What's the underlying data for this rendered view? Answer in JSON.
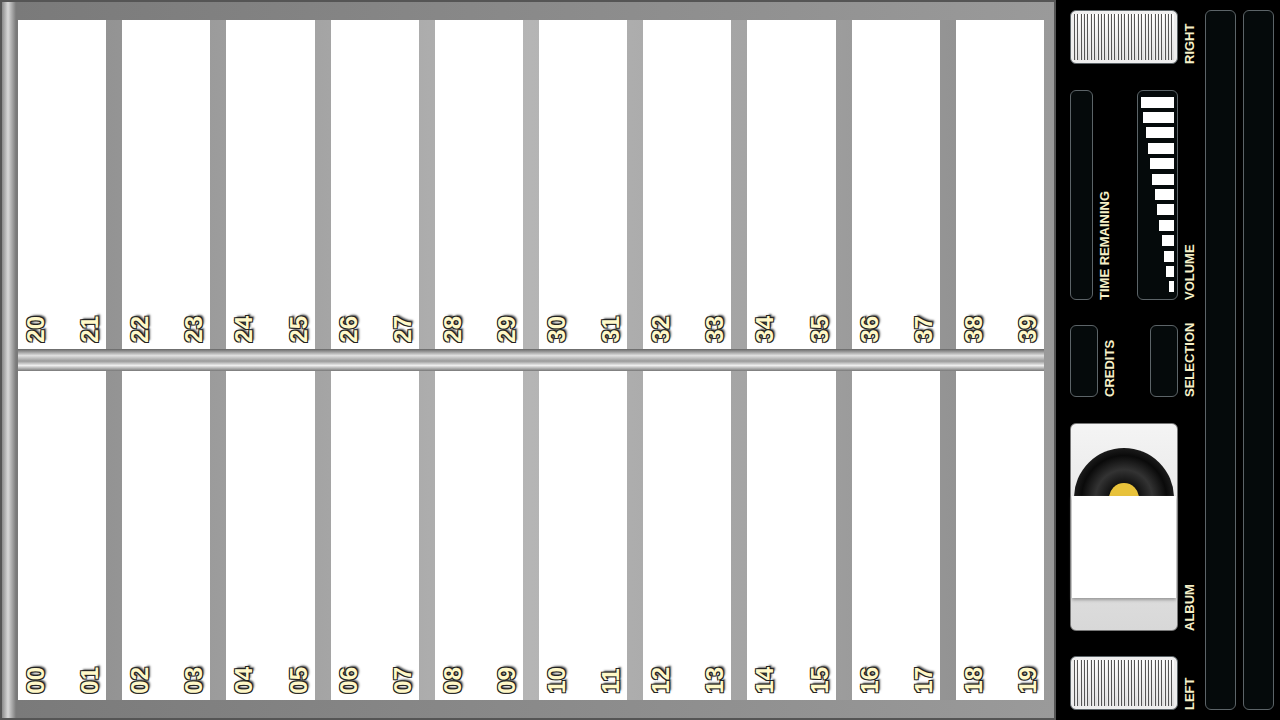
{
  "jukebox": {
    "top_row": [
      {
        "left": "20",
        "right": "21"
      },
      {
        "left": "22",
        "right": "23"
      },
      {
        "left": "24",
        "right": "25"
      },
      {
        "left": "26",
        "right": "27"
      },
      {
        "left": "28",
        "right": "29"
      },
      {
        "left": "30",
        "right": "31"
      },
      {
        "left": "32",
        "right": "33"
      },
      {
        "left": "34",
        "right": "35"
      },
      {
        "left": "36",
        "right": "37"
      },
      {
        "left": "38",
        "right": "39"
      }
    ],
    "bottom_row": [
      {
        "left": "00",
        "right": "01"
      },
      {
        "left": "02",
        "right": "03"
      },
      {
        "left": "04",
        "right": "05"
      },
      {
        "left": "06",
        "right": "07"
      },
      {
        "left": "08",
        "right": "09"
      },
      {
        "left": "10",
        "right": "11"
      },
      {
        "left": "12",
        "right": "13"
      },
      {
        "left": "14",
        "right": "15"
      },
      {
        "left": "16",
        "right": "17"
      },
      {
        "left": "18",
        "right": "19"
      }
    ]
  },
  "panel": {
    "right_meter": {
      "label": "RIGHT",
      "level": 1
    },
    "time_remaining": {
      "label": "TIME REMAINING"
    },
    "volume": {
      "label": "VOLUME",
      "level": 1
    },
    "credits": {
      "label": "CREDITS"
    },
    "selection": {
      "label": "SELECTION"
    },
    "album": {
      "label": "ALBUM"
    },
    "left_meter": {
      "label": "LEFT",
      "level": 1
    }
  }
}
